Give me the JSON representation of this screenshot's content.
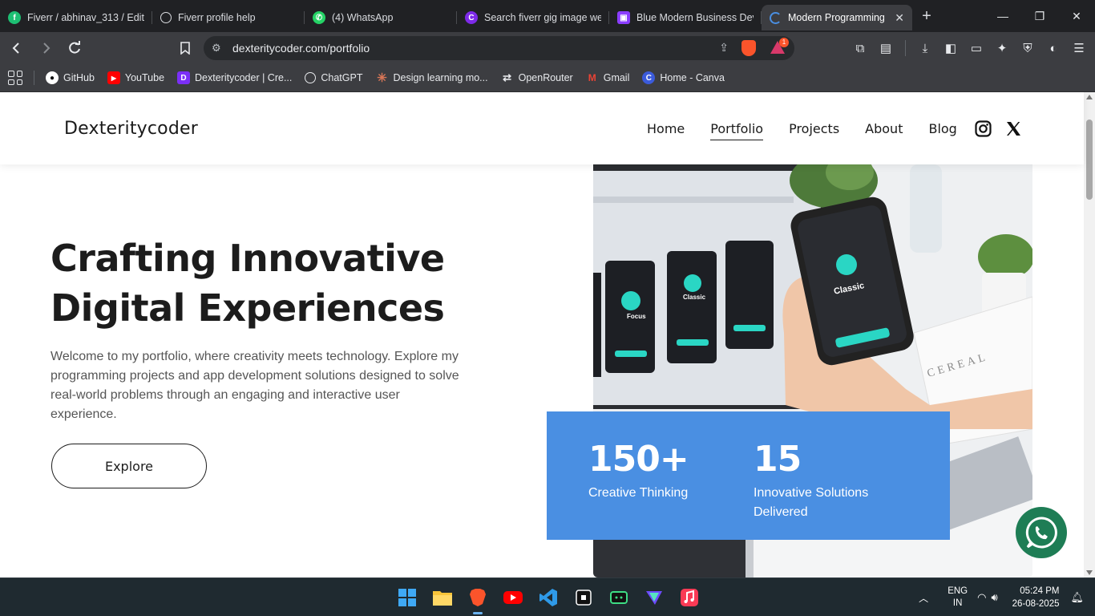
{
  "browser": {
    "tabs": [
      {
        "title": "Fiverr / abhinav_313 / Edit",
        "icon": "fiverr-icon",
        "color": "#1dbf73",
        "glyph": "f"
      },
      {
        "title": "Fiverr profile help",
        "icon": "chatgpt-icon",
        "color": "#3c3d41",
        "glyph": "✱"
      },
      {
        "title": "(4) WhatsApp",
        "icon": "whatsapp-icon",
        "color": "#25d366",
        "glyph": "✆"
      },
      {
        "title": "Search fiverr gig image web",
        "icon": "canva-icon",
        "color": "#7d2ae8",
        "glyph": "C"
      },
      {
        "title": "Blue Modern Business Dev",
        "icon": "canva-doc-icon",
        "color": "#8b3dff",
        "glyph": "▣"
      },
      {
        "title": "Modern Programming",
        "icon": "loading-icon",
        "color": "#4a8fe2",
        "glyph": "◌"
      }
    ],
    "url": "dexteritycoder.com/portfolio",
    "shield_count": "1",
    "bookmarks": [
      {
        "label": "GitHub",
        "color": "#24292e",
        "glyph": "●"
      },
      {
        "label": "YouTube",
        "color": "#ff0000",
        "glyph": "▶"
      },
      {
        "label": "Dexteritycoder | Cre...",
        "color": "#7b2ff7",
        "glyph": "D"
      },
      {
        "label": "ChatGPT",
        "color": "#3c3d41",
        "glyph": "✱"
      },
      {
        "label": "Design learning mo...",
        "color": "#d97757",
        "glyph": "✳"
      },
      {
        "label": "OpenRouter",
        "color": "#3c3d41",
        "glyph": "⇄"
      },
      {
        "label": "Gmail",
        "color": "#ea4335",
        "glyph": "M"
      },
      {
        "label": "Home - Canva",
        "color": "#00c4cc",
        "glyph": "C"
      }
    ]
  },
  "site": {
    "logo": "Dexteritycoder",
    "nav": [
      "Home",
      "Portfolio",
      "Projects",
      "About",
      "Blog"
    ],
    "active_nav": "Portfolio",
    "hero_title_line1": "Crafting Innovative",
    "hero_title_line2": "Digital Experiences",
    "hero_text": "Welcome to my portfolio, where creativity meets technology. Explore my programming projects and app development solutions designed to solve real-world problems through an engaging and interactive user experience.",
    "explore_label": "Explore",
    "stats": [
      {
        "number": "150+",
        "label": "Creative Thinking"
      },
      {
        "number": "15",
        "label": "Innovative Solutions Delivered"
      }
    ],
    "image_texts": {
      "phone_app": "Classic",
      "screen_app_1": "Focus",
      "screen_app_2": "Classic",
      "magazine": "CEREAL"
    },
    "accent_color": "#4a8fe2",
    "whatsapp_color": "#1e7d55"
  },
  "taskbar": {
    "lang_top": "ENG",
    "lang_bottom": "IN",
    "time": "05:24 PM",
    "date": "26-08-2025"
  }
}
